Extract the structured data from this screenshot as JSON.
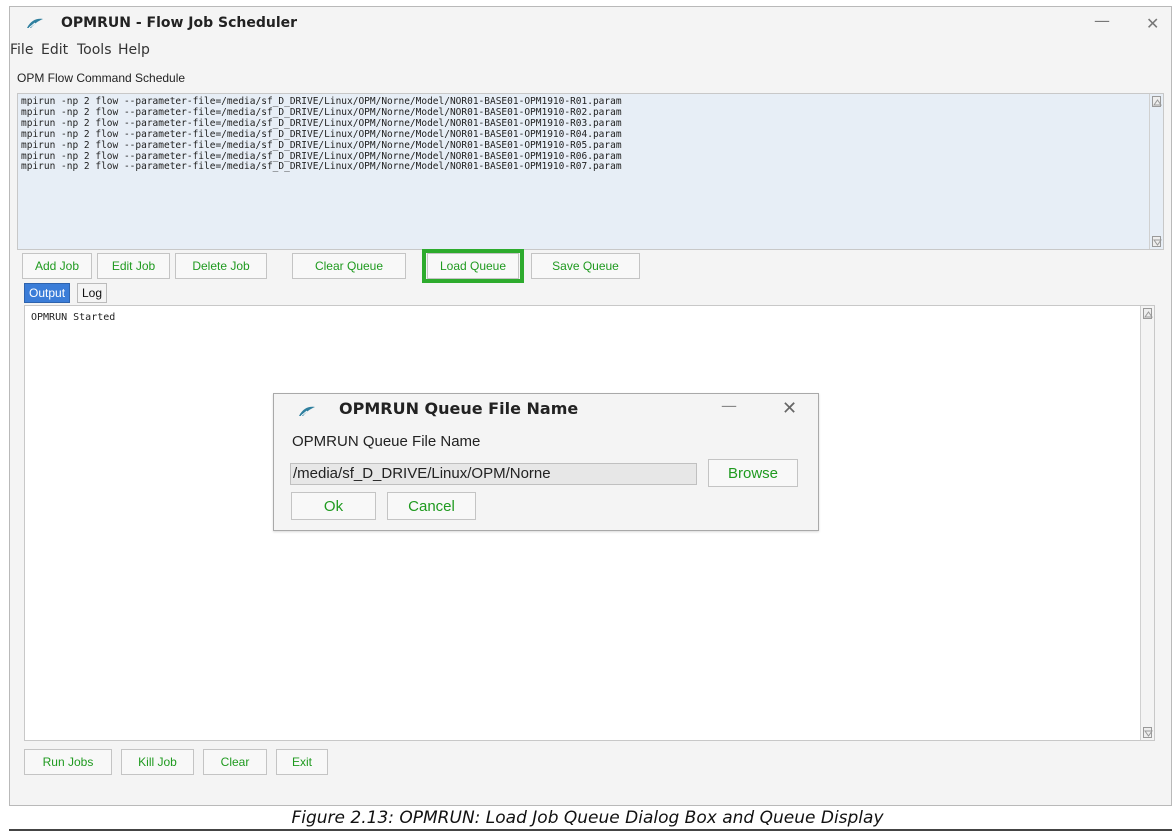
{
  "window": {
    "title": "OPMRUN - Flow Job Scheduler",
    "icon": "opm-leaf-icon"
  },
  "menu": [
    "File",
    "Edit",
    "Tools",
    "Help"
  ],
  "schedule": {
    "label": "OPM Flow Command Schedule",
    "commands": [
      "mpirun -np 2 flow --parameter-file=/media/sf_D_DRIVE/Linux/OPM/Norne/Model/NOR01-BASE01-OPM1910-R01.param",
      "mpirun -np 2 flow --parameter-file=/media/sf_D_DRIVE/Linux/OPM/Norne/Model/NOR01-BASE01-OPM1910-R02.param",
      "mpirun -np 2 flow --parameter-file=/media/sf_D_DRIVE/Linux/OPM/Norne/Model/NOR01-BASE01-OPM1910-R03.param",
      "mpirun -np 2 flow --parameter-file=/media/sf_D_DRIVE/Linux/OPM/Norne/Model/NOR01-BASE01-OPM1910-R04.param",
      "mpirun -np 2 flow --parameter-file=/media/sf_D_DRIVE/Linux/OPM/Norne/Model/NOR01-BASE01-OPM1910-R05.param",
      "mpirun -np 2 flow --parameter-file=/media/sf_D_DRIVE/Linux/OPM/Norne/Model/NOR01-BASE01-OPM1910-R06.param",
      "mpirun -np 2 flow --parameter-file=/media/sf_D_DRIVE/Linux/OPM/Norne/Model/NOR01-BASE01-OPM1910-R07.param"
    ]
  },
  "queue_buttons": {
    "add": "Add Job",
    "edit": "Edit Job",
    "delete": "Delete Job",
    "clear": "Clear Queue",
    "load": "Load Queue",
    "save": "Save Queue"
  },
  "tabs": {
    "output": "Output",
    "log": "Log"
  },
  "output": {
    "text": "OPMRUN Started"
  },
  "bottom_buttons": {
    "run": "Run Jobs",
    "kill": "Kill Job",
    "clear": "Clear",
    "exit": "Exit"
  },
  "dialog": {
    "title": "OPMRUN Queue File Name",
    "label": "OPMRUN Queue File Name",
    "path_value": "/media/sf_D_DRIVE/Linux/OPM/Norne",
    "browse": "Browse",
    "ok": "Ok",
    "cancel": "Cancel"
  },
  "colors": {
    "button_text": "#1f9a1f",
    "highlight": "#2dab2d",
    "active_tab": "#3b7dd8",
    "command_bg": "#e7eef6"
  },
  "caption": "Figure 2.13: OPMRUN: Load Job Queue Dialog Box and Queue Display"
}
